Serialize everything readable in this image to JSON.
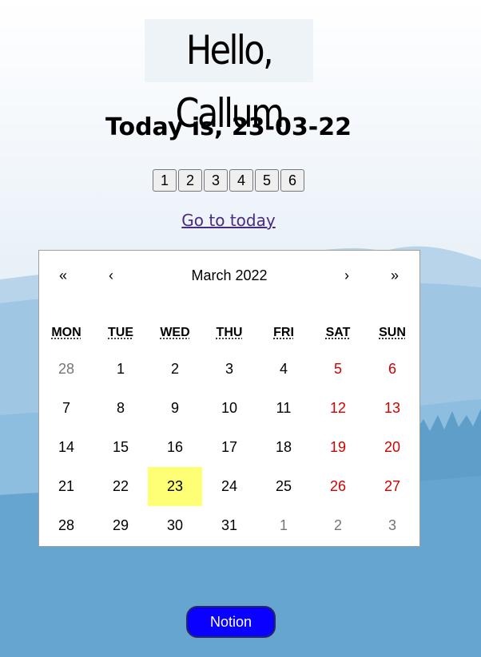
{
  "greeting": "Hello, Callum",
  "today_heading": "Today is, 23-03-22",
  "tabs": [
    "1",
    "2",
    "3",
    "4",
    "5",
    "6"
  ],
  "goto_today": "Go to today",
  "calendar": {
    "nav": {
      "prev_year": "«",
      "prev_month": "‹",
      "next_month": "›",
      "next_year": "»"
    },
    "month_label": "March 2022",
    "weekdays": [
      "MON",
      "TUE",
      "WED",
      "THU",
      "FRI",
      "SAT",
      "SUN"
    ],
    "days": [
      {
        "d": "28",
        "neighbor": true,
        "weekend": false
      },
      {
        "d": "1",
        "neighbor": false,
        "weekend": false
      },
      {
        "d": "2",
        "neighbor": false,
        "weekend": false
      },
      {
        "d": "3",
        "neighbor": false,
        "weekend": false
      },
      {
        "d": "4",
        "neighbor": false,
        "weekend": false
      },
      {
        "d": "5",
        "neighbor": false,
        "weekend": true
      },
      {
        "d": "6",
        "neighbor": false,
        "weekend": true
      },
      {
        "d": "7",
        "neighbor": false,
        "weekend": false
      },
      {
        "d": "8",
        "neighbor": false,
        "weekend": false
      },
      {
        "d": "9",
        "neighbor": false,
        "weekend": false
      },
      {
        "d": "10",
        "neighbor": false,
        "weekend": false
      },
      {
        "d": "11",
        "neighbor": false,
        "weekend": false
      },
      {
        "d": "12",
        "neighbor": false,
        "weekend": true
      },
      {
        "d": "13",
        "neighbor": false,
        "weekend": true
      },
      {
        "d": "14",
        "neighbor": false,
        "weekend": false
      },
      {
        "d": "15",
        "neighbor": false,
        "weekend": false
      },
      {
        "d": "16",
        "neighbor": false,
        "weekend": false
      },
      {
        "d": "17",
        "neighbor": false,
        "weekend": false
      },
      {
        "d": "18",
        "neighbor": false,
        "weekend": false
      },
      {
        "d": "19",
        "neighbor": false,
        "weekend": true
      },
      {
        "d": "20",
        "neighbor": false,
        "weekend": true
      },
      {
        "d": "21",
        "neighbor": false,
        "weekend": false
      },
      {
        "d": "22",
        "neighbor": false,
        "weekend": false
      },
      {
        "d": "23",
        "neighbor": false,
        "weekend": false,
        "today": true
      },
      {
        "d": "24",
        "neighbor": false,
        "weekend": false
      },
      {
        "d": "25",
        "neighbor": false,
        "weekend": false
      },
      {
        "d": "26",
        "neighbor": false,
        "weekend": true
      },
      {
        "d": "27",
        "neighbor": false,
        "weekend": true
      },
      {
        "d": "28",
        "neighbor": false,
        "weekend": false
      },
      {
        "d": "29",
        "neighbor": false,
        "weekend": false
      },
      {
        "d": "30",
        "neighbor": false,
        "weekend": false
      },
      {
        "d": "31",
        "neighbor": false,
        "weekend": false
      },
      {
        "d": "1",
        "neighbor": true,
        "weekend": false
      },
      {
        "d": "2",
        "neighbor": true,
        "weekend": false
      },
      {
        "d": "3",
        "neighbor": true,
        "weekend": false
      }
    ]
  },
  "notion_button": "Notion",
  "colors": {
    "today_highlight": "#ffff76",
    "weekend": "#d10000",
    "neighbor": "#757575",
    "notion_bg": "#0a00ff",
    "link": "#4b2a82"
  }
}
